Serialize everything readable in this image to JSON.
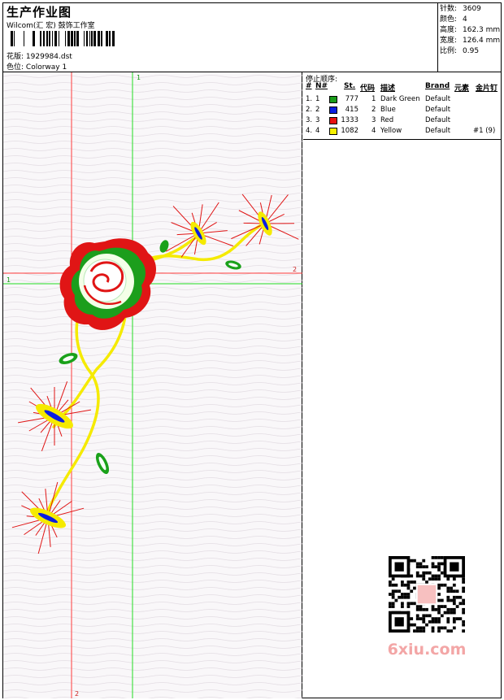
{
  "header": {
    "title": "生产作业图",
    "company": "Wilcom(汇 宏) 鼓饰工作室",
    "design_label": "花版:",
    "design_value": "1929984.dst",
    "colorway_label": "色位:",
    "colorway_value": "Colorway 1"
  },
  "stats": [
    {
      "label": "针数:",
      "value": "3609"
    },
    {
      "label": "颜色:",
      "value": "4"
    },
    {
      "label": "高度:",
      "value": "162.3 mm"
    },
    {
      "label": "宽度:",
      "value": "126.4 mm"
    },
    {
      "label": "比例:",
      "value": "0.95"
    }
  ],
  "stop_sequence": {
    "title": "停止顺序:",
    "headers": [
      "#",
      "N#",
      "St.",
      "代码",
      "描述",
      "Brand",
      "元素",
      "金片钉"
    ],
    "rows": [
      {
        "num": "1.",
        "n": "1",
        "color": "#1a9c1a",
        "st": "777",
        "code": "1",
        "desc": "Dark Green",
        "brand": "Default",
        "elem": "",
        "seq": ""
      },
      {
        "num": "2.",
        "n": "2",
        "color": "#0a1ee0",
        "st": "415",
        "code": "2",
        "desc": "Blue",
        "brand": "Default",
        "elem": "",
        "seq": ""
      },
      {
        "num": "3.",
        "n": "3",
        "color": "#e81010",
        "st": "1333",
        "code": "3",
        "desc": "Red",
        "brand": "Default",
        "elem": "",
        "seq": ""
      },
      {
        "num": "4.",
        "n": "4",
        "color": "#f5f000",
        "st": "1082",
        "code": "4",
        "desc": "Yellow",
        "brand": "Default",
        "elem": "",
        "seq": "#1 (9)"
      }
    ]
  },
  "guides": {
    "v_left": "2",
    "v_right": "1",
    "h_top": "2",
    "h_bottom": "1"
  },
  "watermark": "6xiu.com"
}
